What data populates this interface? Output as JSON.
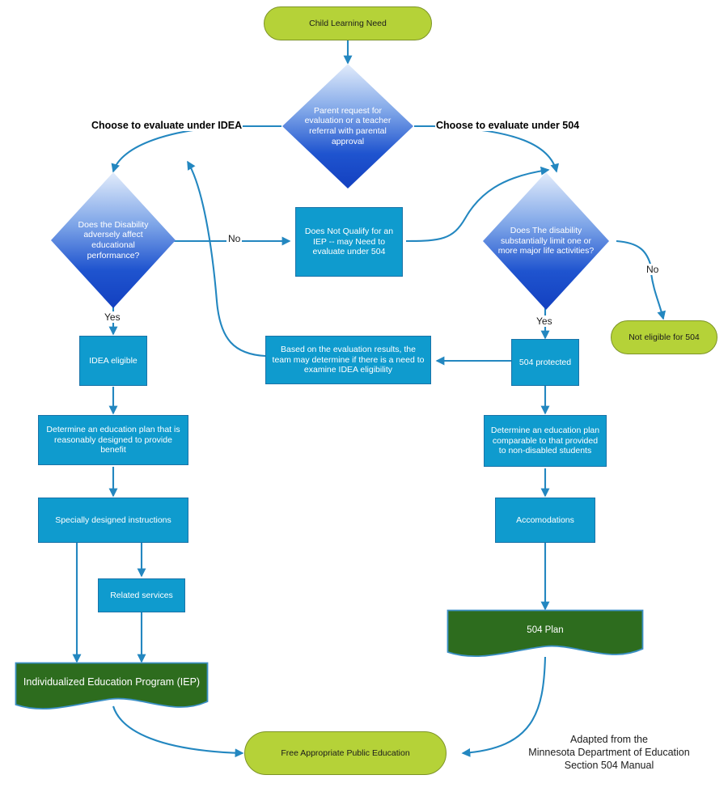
{
  "diagram": {
    "title": "IDEA vs Section 504 Evaluation Flowchart",
    "colors": {
      "terminator_fill": "#b5d238",
      "terminator_stroke": "#7d9427",
      "process_fill": "#0f9bce",
      "process_stroke": "#1a73a8",
      "decision_gradient_top": "#cfe0f7",
      "decision_gradient_bottom": "#1545c4",
      "document_fill": "#2d6c1e",
      "document_stroke": "#3b8fc4",
      "connector": "#2387c0",
      "text_dark": "#1b1b1b",
      "text_light": "#ffffff"
    },
    "nodes": {
      "start": "Child Learning Need",
      "parent_request": "Parent request for evaluation or a teacher referral with parental approval",
      "idea_disability_question": "Does the Disability adversely affect educational performance?",
      "not_qualify_iep": "Does Not Qualify for an IEP -- may Need to evaluate under 504",
      "limit_life_activities_question": "Does The disability substantially limit one or more major life activities?",
      "not_eligible_504": "Not eligible for 504",
      "idea_eligible": "IDEA eligible",
      "evaluation_results": "Based on the evaluation results, the team may determine if there is a need to examine IDEA eligibility",
      "protected_504": "504 protected",
      "determine_plan_idea": "Determine an education plan that is reasonably designed to provide benefit",
      "determine_plan_504": "Determine an education plan comparable to that provided to non-disabled students",
      "specially_designed": "Specially designed instructions",
      "related_services": "Related services",
      "accommodations": "Accomodations",
      "iep_document": "Individualized Education Program (IEP)",
      "plan_504_document": "504 Plan",
      "fape": "Free Appropriate Public Education"
    },
    "edge_labels": {
      "choose_idea": "Choose to evaluate under IDEA",
      "choose_504": "Choose to evaluate under 504",
      "no_idea": "No",
      "no_504": "No",
      "yes_idea": "Yes",
      "yes_504": "Yes"
    },
    "credit": {
      "line1": "Adapted from the",
      "line2": "Minnesota Department of Education",
      "line3": "Section 504 Manual"
    }
  }
}
